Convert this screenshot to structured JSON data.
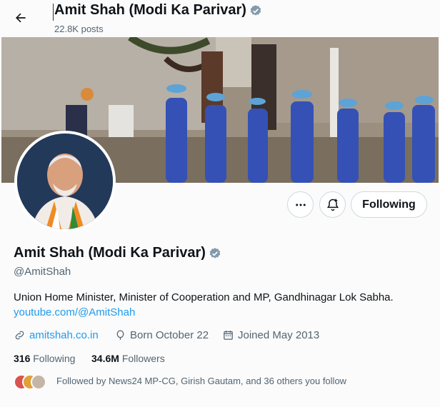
{
  "header": {
    "title": "Amit Shah (Modi Ka Parivar)",
    "posts": "22.8K posts"
  },
  "profile": {
    "name": "Amit Shah (Modi Ka Parivar)",
    "handle": "@AmitShah",
    "bio": "Union Home Minister, Minister of Cooperation and MP, Gandhinagar Lok Sabha.",
    "bio_link": "youtube.com/@AmitShah",
    "website": "amitshah.co.in",
    "born": "Born October 22",
    "joined": "Joined May 2013",
    "following_count": "316",
    "following_label": "Following",
    "followers_count": "34.6M",
    "followers_label": "Followers",
    "followed_by": "Followed by News24 MP-CG, Girish Gautam, and 36 others you follow"
  },
  "actions": {
    "follow_button": "Following"
  },
  "colors": {
    "verified_badge": "#829aab",
    "link": "#1d9bf0",
    "secondary_text": "#536471"
  },
  "icons": [
    "back-arrow-icon",
    "verified-badge-icon",
    "more-icon",
    "notification-bell-icon",
    "link-icon",
    "birthday-icon",
    "calendar-icon"
  ]
}
